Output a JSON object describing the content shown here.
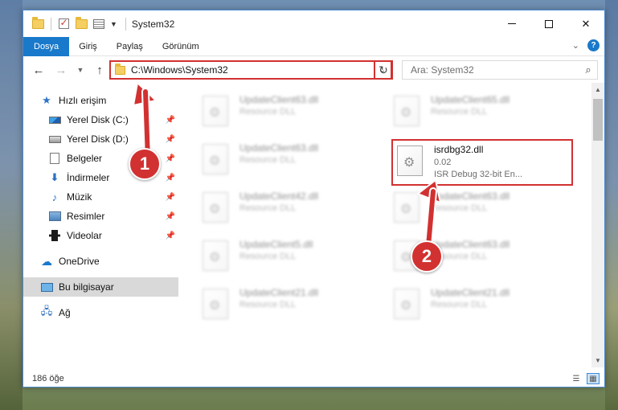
{
  "window": {
    "title": "System32",
    "controls": {
      "minimize": "minimize",
      "maximize": "maximize",
      "close": "✕"
    }
  },
  "ribbon": {
    "tabs": [
      {
        "label": "Dosya",
        "active": true
      },
      {
        "label": "Giriş"
      },
      {
        "label": "Paylaş"
      },
      {
        "label": "Görünüm"
      }
    ],
    "help": "?"
  },
  "navigation": {
    "address": "C:\\Windows\\System32",
    "search_placeholder": "Ara: System32"
  },
  "sidebar": {
    "items": [
      {
        "label": "Hızlı erişim",
        "icon": "star-icon"
      },
      {
        "label": "Yerel Disk (C:)",
        "icon": "drive-icon",
        "pinned": true
      },
      {
        "label": "Yerel Disk (D:)",
        "icon": "drive-icon",
        "pinned": true
      },
      {
        "label": "Belgeler",
        "icon": "document-icon",
        "pinned": true
      },
      {
        "label": "İndirmeler",
        "icon": "download-icon",
        "pinned": true
      },
      {
        "label": "Müzik",
        "icon": "music-icon",
        "pinned": true
      },
      {
        "label": "Resimler",
        "icon": "pictures-icon",
        "pinned": true
      },
      {
        "label": "Videolar",
        "icon": "videos-icon",
        "pinned": true
      },
      {
        "label": "OneDrive",
        "icon": "cloud-icon"
      },
      {
        "label": "Bu bilgisayar",
        "icon": "computer-icon",
        "selected": true
      },
      {
        "label": "Ağ",
        "icon": "network-icon"
      }
    ]
  },
  "files": {
    "left_column": [
      {
        "name": "UpdateClient63.dll",
        "type": "Resource DLL"
      },
      {
        "name": "UpdateClient63.dll",
        "type": "Resource DLL"
      },
      {
        "name": "UpdateClient42.dll",
        "type": "Resource DLL"
      },
      {
        "name": "UpdateClient5.dll",
        "type": "Resource DLL"
      },
      {
        "name": "UpdateClient21.dll",
        "type": "Resource DLL"
      }
    ],
    "right_column": [
      {
        "name": "UpdateClient65.dll",
        "type": "Resource DLL"
      },
      {
        "name": "UpdateClient63.dll",
        "type": "Resource DLL"
      },
      {
        "name": "UpdateClient63.dll",
        "type": "Resource DLL"
      },
      {
        "name": "UpdateClient21.dll",
        "type": "Resource DLL"
      }
    ],
    "highlighted": {
      "name": "isrdbg32.dll",
      "version": "0.02",
      "description": "ISR Debug 32-bit En..."
    }
  },
  "status": {
    "item_count": "186 öğe"
  },
  "callouts": [
    {
      "label": "1",
      "color": "#d23131"
    },
    {
      "label": "2",
      "color": "#d23131"
    }
  ]
}
